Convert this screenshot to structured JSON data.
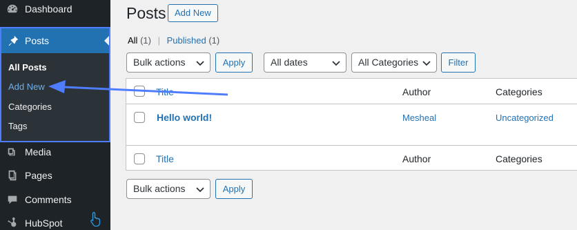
{
  "sidebar": {
    "dashboard": "Dashboard",
    "posts": "Posts",
    "submenu": {
      "all_posts": "All Posts",
      "add_new": "Add New",
      "categories": "Categories",
      "tags": "Tags"
    },
    "media": "Media",
    "pages": "Pages",
    "comments": "Comments",
    "hubspot": "HubSpot"
  },
  "header": {
    "title": "Posts",
    "add_new": "Add New"
  },
  "filters": {
    "all": "All",
    "all_count": "(1)",
    "separator": "|",
    "published": "Published",
    "published_count": "(1)"
  },
  "toolbar_top": {
    "bulk_actions": "Bulk actions",
    "apply": "Apply",
    "dates": "All dates",
    "categories": "All Categories",
    "filter": "Filter"
  },
  "table": {
    "columns": [
      "Title",
      "Author",
      "Categories"
    ],
    "rows": [
      {
        "title": "Hello world!",
        "author": "Mesheal",
        "categories": "Uncategorized"
      }
    ]
  },
  "toolbar_bottom": {
    "bulk_actions": "Bulk actions",
    "apply": "Apply"
  },
  "colors": {
    "sidebar_bg": "#1d2327",
    "accent": "#2271b1",
    "annotation": "#4f7dff"
  }
}
